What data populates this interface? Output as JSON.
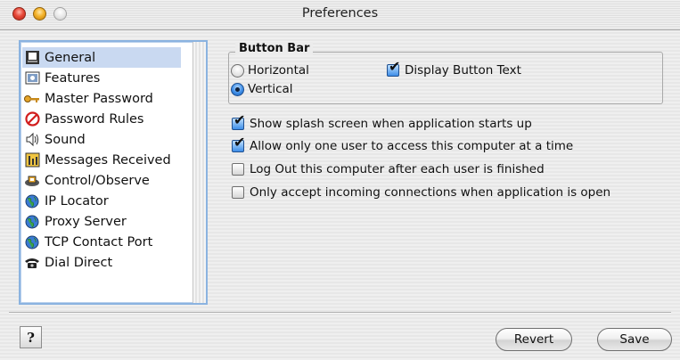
{
  "window": {
    "title": "Preferences"
  },
  "sidebar": {
    "items": [
      {
        "label": "General",
        "icon": "general-icon",
        "selected": true
      },
      {
        "label": "Features",
        "icon": "features-icon"
      },
      {
        "label": "Master Password",
        "icon": "key-icon"
      },
      {
        "label": "Password Rules",
        "icon": "prohibited-icon"
      },
      {
        "label": "Sound",
        "icon": "speaker-icon"
      },
      {
        "label": "Messages Received",
        "icon": "messages-icon"
      },
      {
        "label": "Control/Observe",
        "icon": "control-icon"
      },
      {
        "label": "IP Locator",
        "icon": "globe-icon"
      },
      {
        "label": "Proxy Server",
        "icon": "globe-icon"
      },
      {
        "label": "TCP Contact Port",
        "icon": "globe-icon"
      },
      {
        "label": "Dial Direct",
        "icon": "telephone-icon"
      }
    ]
  },
  "button_bar": {
    "title": "Button Bar",
    "horizontal": {
      "label": "Horizontal",
      "checked": false
    },
    "vertical": {
      "label": "Vertical",
      "checked": true
    },
    "display_text": {
      "label": "Display Button Text",
      "checked": true
    }
  },
  "options": [
    {
      "label": "Show splash screen when application starts up",
      "checked": true
    },
    {
      "label": "Allow only one user to access this computer at a time",
      "checked": true
    },
    {
      "label": "Log Out this computer after each user is finished",
      "checked": false
    },
    {
      "label": "Only accept incoming connections when application is open",
      "checked": false
    }
  ],
  "footer": {
    "help_label": "?",
    "revert_label": "Revert",
    "save_label": "Save"
  },
  "colors": {
    "selection": "#c9d9f1",
    "focus_ring": "#8bb3e0",
    "accent": "#3e8ee8"
  }
}
